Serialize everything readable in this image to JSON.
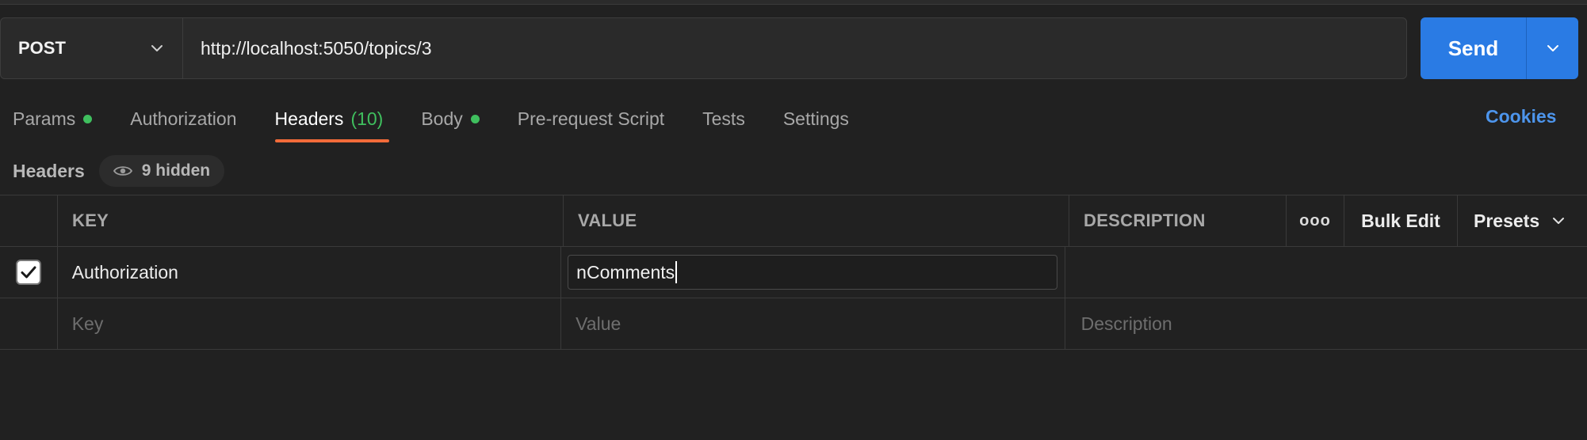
{
  "request": {
    "method": "POST",
    "url": "http://localhost:5050/topics/3",
    "send_label": "Send"
  },
  "tabs": [
    {
      "label": "Params",
      "dot": true
    },
    {
      "label": "Authorization",
      "dot": false
    },
    {
      "label": "Headers",
      "count": "(10)",
      "active": true
    },
    {
      "label": "Body",
      "dot": true
    },
    {
      "label": "Pre-request Script"
    },
    {
      "label": "Tests"
    },
    {
      "label": "Settings"
    }
  ],
  "cookies_label": "Cookies",
  "subheader": {
    "title": "Headers",
    "hidden_label": "9 hidden"
  },
  "table": {
    "columns": {
      "key": "KEY",
      "value": "VALUE",
      "description": "DESCRIPTION",
      "more": "ooo",
      "bulk_edit": "Bulk Edit",
      "presets": "Presets"
    },
    "rows": [
      {
        "checked": true,
        "key": "Authorization",
        "value": "nComments",
        "description": ""
      }
    ],
    "placeholders": {
      "key": "Key",
      "value": "Value",
      "description": "Description"
    }
  },
  "colors": {
    "accent_send": "#2a7be4",
    "active_tab_underline": "#f26b3a",
    "status_dot": "#3fbf5e",
    "link": "#4d95ec"
  },
  "icons": [
    "chevron-down-icon",
    "eye-icon",
    "check-icon"
  ]
}
